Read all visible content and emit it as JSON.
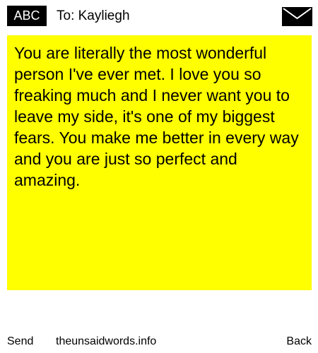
{
  "header": {
    "badge_label": "ABC",
    "to_label": "To: Kayliegh",
    "envelope_icon": "envelope-icon"
  },
  "message": {
    "text": "You are literally the most wonderful person I've ever met. I love you so freaking much and I never want you to leave my side, it's one of my biggest fears. You make me better in every way and you are just so perfect and amazing.",
    "background_color": "#ffff00"
  },
  "footer": {
    "send_label": "Send",
    "site_label": "theunsaidwords.info",
    "back_label": "Back"
  }
}
